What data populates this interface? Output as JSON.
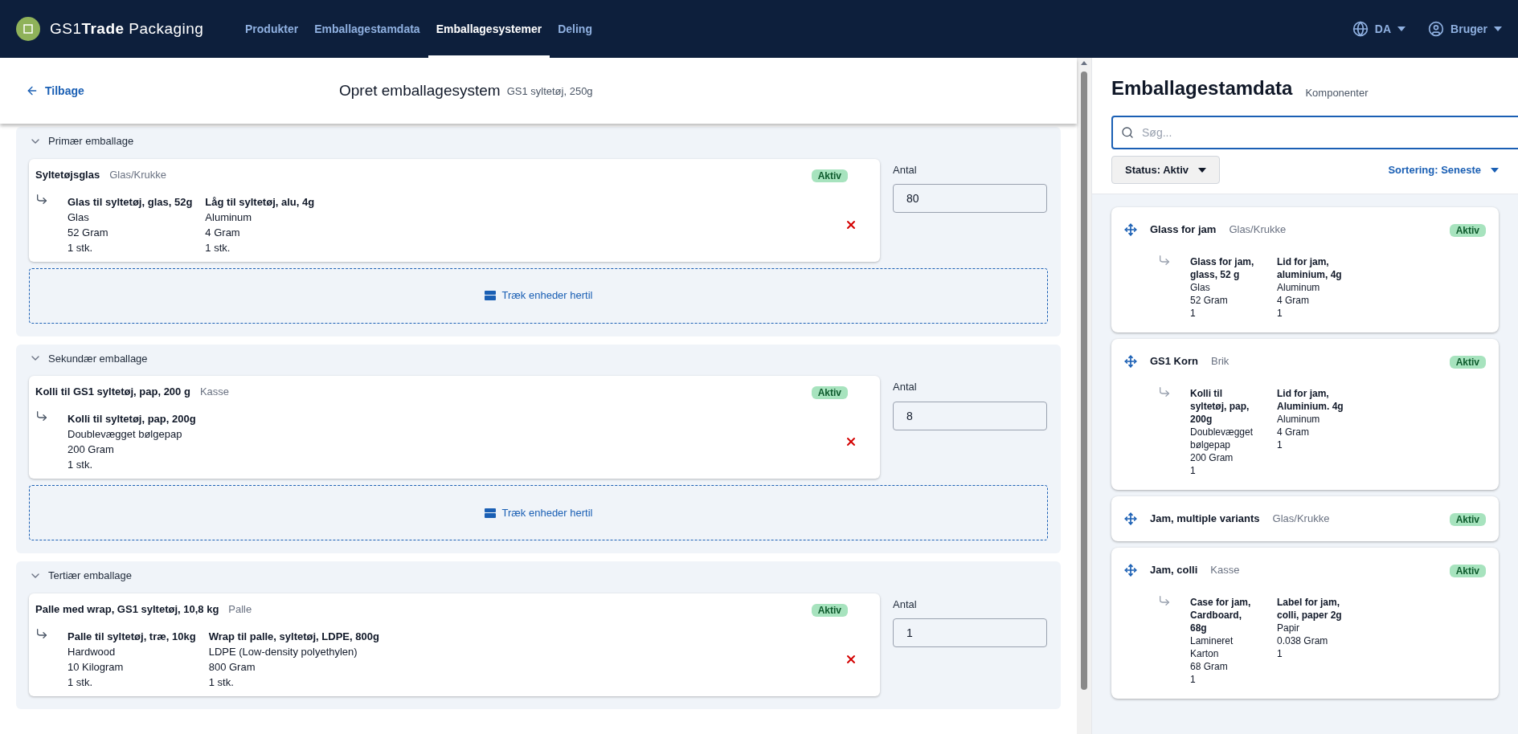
{
  "header": {
    "logo": "GS1**Trade** Packaging",
    "nav": [
      {
        "label": "Produkter",
        "selected": false
      },
      {
        "label": "Emballagestamdata",
        "selected": false
      },
      {
        "label": "Emballagesystemer",
        "selected": true
      },
      {
        "label": "Deling",
        "selected": false
      }
    ],
    "language": "DA",
    "user": "Bruger"
  },
  "page": {
    "back": "Tilbage",
    "title": "Opret emballagesystem",
    "subtitle": "GS1 syltetøj, 250g"
  },
  "groups": [
    {
      "title": "Primær emballage",
      "expanded": true,
      "item": {
        "name": "Syltetøjsglas",
        "type": "Glas/Krukke",
        "status": "Aktiv",
        "components": [
          {
            "name": "Glas til syltetøj, glas, 52g",
            "material": "Glas",
            "weight": "52 Gram",
            "count": "1 stk."
          },
          {
            "name": "Låg til syltetøj, alu, 4g",
            "material": "Aluminum",
            "weight": "4 Gram",
            "count": "1 stk."
          }
        ]
      },
      "quantity_label": "Antal",
      "quantity": "80",
      "dropzone": "Træk enheder hertil"
    },
    {
      "title": "Sekundær emballage",
      "expanded": true,
      "item": {
        "name": "Kolli til GS1 syltetøj, pap, 200 g",
        "type": "Kasse",
        "status": "Aktiv",
        "components": [
          {
            "name": "Kolli til syltetøj, pap, 200g",
            "material": "Doublevægget bølgepap",
            "weight": "200 Gram",
            "count": "1 stk."
          }
        ]
      },
      "quantity_label": "Antal",
      "quantity": "8",
      "dropzone": "Træk enheder hertil"
    },
    {
      "title": "Tertiær emballage",
      "expanded": true,
      "item": {
        "name": "Palle med wrap, GS1 syltetøj, 10,8 kg",
        "type": "Palle",
        "status": "Aktiv",
        "components": [
          {
            "name": "Palle til syltetøj, træ, 10kg",
            "material": "Hardwood",
            "weight": "10 Kilogram",
            "count": "1 stk."
          },
          {
            "name": "Wrap til palle, syltetøj, LDPE, 800g",
            "material": "LDPE (Low-density polyethylen)",
            "weight": "800 Gram",
            "count": "1 stk."
          }
        ]
      },
      "quantity_label": "Antal",
      "quantity": "1"
    }
  ],
  "panel": {
    "title": "Emballagestamdata",
    "subtitle": "Komponenter",
    "search": {
      "placeholder": "Søg..."
    },
    "status_filter": "Status: Aktiv",
    "sort": "Sortering: Seneste",
    "items": [
      {
        "name": "Glass for jam",
        "type": "Glas/Krukke",
        "status": "Aktiv",
        "components": [
          {
            "name": "Glass for jam, glass, 52 g",
            "material": "Glas",
            "weight": "52 Gram",
            "count": "1"
          },
          {
            "name": "Lid for jam, aluminium, 4g",
            "material": "Aluminum",
            "weight": "4 Gram",
            "count": "1"
          }
        ]
      },
      {
        "name": "GS1 Korn",
        "type": "Brik",
        "status": "Aktiv",
        "components": [
          {
            "name": "Kolli til syltetøj, pap, 200g",
            "material": "Doublevægget bølgepap",
            "weight": "200 Gram",
            "count": "1"
          },
          {
            "name": "Lid for jam, Aluminium. 4g",
            "material": "Aluminum",
            "weight": "4 Gram",
            "count": "1"
          }
        ]
      },
      {
        "name": "Jam, multiple variants",
        "type": "Glas/Krukke",
        "status": "Aktiv"
      },
      {
        "name": "Jam, colli",
        "type": "Kasse",
        "status": "Aktiv",
        "components": [
          {
            "name": "Case for jam, Cardboard, 68g",
            "material": "Lamineret Karton",
            "weight": "68 Gram",
            "count": "1"
          },
          {
            "name": "Label for jam, colli, paper 2g",
            "material": "Papir",
            "weight": "0.038 Gram",
            "count": "1"
          }
        ]
      }
    ]
  }
}
